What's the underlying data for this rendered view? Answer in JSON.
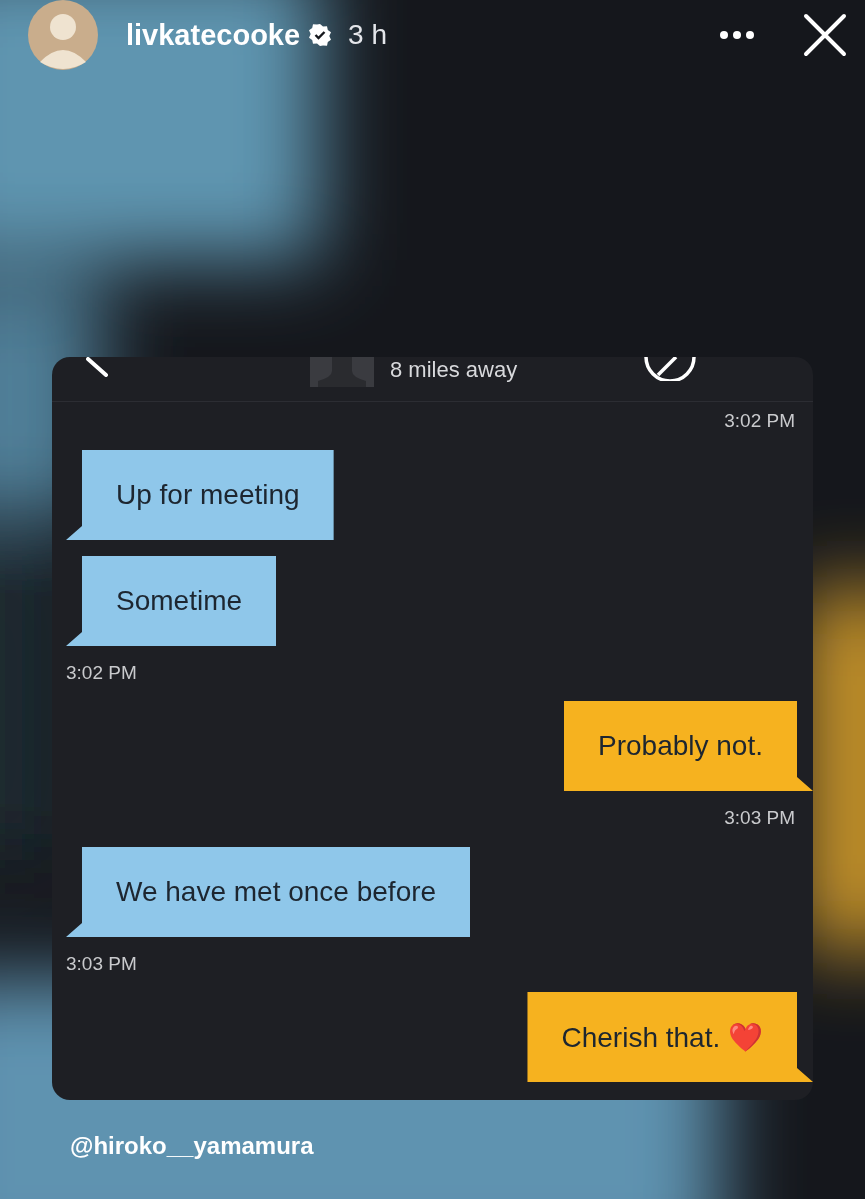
{
  "story": {
    "username": "livkatecooke",
    "verified": true,
    "time_ago": "3 h"
  },
  "chat": {
    "header": {
      "distance": "8 miles away"
    },
    "messages": [
      {
        "kind": "time",
        "outgoing": true,
        "text": "3:02 PM"
      },
      {
        "kind": "bubble",
        "outgoing": false,
        "text": "Up for meeting"
      },
      {
        "kind": "bubble",
        "outgoing": false,
        "text": "Sometime"
      },
      {
        "kind": "time",
        "outgoing": false,
        "text": "3:02 PM"
      },
      {
        "kind": "bubble",
        "outgoing": true,
        "text": "Probably not."
      },
      {
        "kind": "time",
        "outgoing": true,
        "text": "3:03 PM"
      },
      {
        "kind": "bubble",
        "outgoing": false,
        "text": "We have met once before"
      },
      {
        "kind": "time",
        "outgoing": false,
        "text": "3:03 PM"
      },
      {
        "kind": "bubble",
        "outgoing": true,
        "text": "Cherish that. ❤️"
      }
    ]
  },
  "caption": "@hiroko__yamamura"
}
